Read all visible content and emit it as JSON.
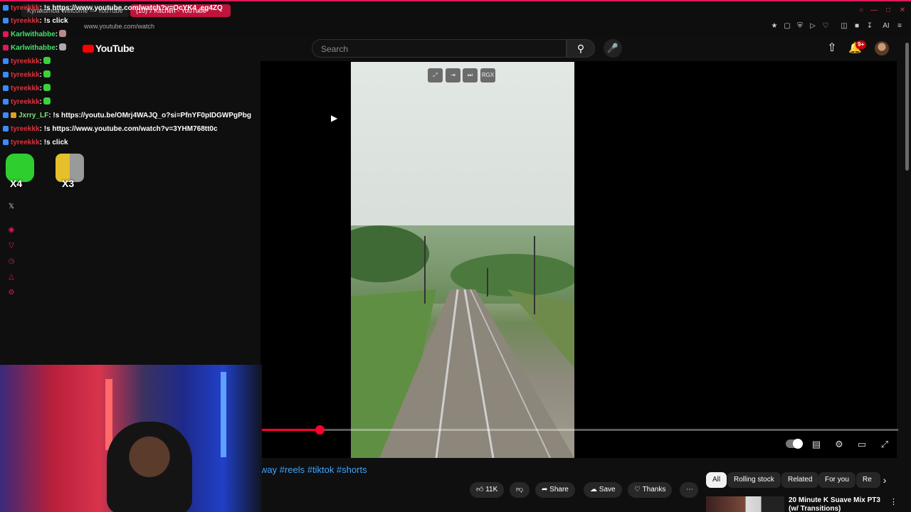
{
  "browser": {
    "tabs": [
      "Kyrakumba Welcome — YouTube",
      "(10) ♪ Kitchen - YouTube"
    ],
    "url": "www.youtube.com/watch"
  },
  "youtube": {
    "logo_text": "YouTube",
    "search_placeholder": "Search",
    "notification_count": "9+"
  },
  "player": {
    "overlay_buttons": [
      "⤢",
      "⇥",
      "⏭",
      "RGX"
    ],
    "progress_fraction": 0.093
  },
  "video": {
    "title_visible": "way #reels #tiktok #shorts",
    "actions": {
      "like_count": "11K",
      "share": "Share",
      "save": "Save",
      "thanks": "Thanks"
    }
  },
  "chips": [
    "All",
    "Rolling stock",
    "Related",
    "For you",
    "Re"
  ],
  "recommendation": {
    "title": "20 Minute K Suave Mix PT3 (w/ Transitions)"
  },
  "chat": [
    {
      "user": "tyreekkk",
      "message": ": !s https://www.youtube.com/watch?v=OcYK4_eg4ZQ",
      "style": "red",
      "emote": false
    },
    {
      "user": "tyreekkk",
      "message": ": !s click",
      "style": "red",
      "emote": false
    },
    {
      "user": "Karlwithabbe",
      "message": ":",
      "style": "green",
      "emote": true
    },
    {
      "user": "Karlwithabbe",
      "message": ":",
      "style": "green",
      "emote": true
    },
    {
      "user": "tyreekkk",
      "message": ":",
      "style": "red",
      "emote": true
    },
    {
      "user": "tyreekkk",
      "message": ":",
      "style": "red",
      "emote": true
    },
    {
      "user": "tyreekkk",
      "message": ":",
      "style": "red",
      "emote": true
    },
    {
      "user": "tyreekkk",
      "message": ":",
      "style": "red",
      "emote": true
    },
    {
      "user": "Jxrry_LF",
      "message": ": !s https://youtu.be/OMrj4WAJQ_o?si=PfnYF0pIDGWPgPbg",
      "style": "lgreen",
      "emote": false
    },
    {
      "user": "tyreekkk",
      "message": ": !s https://www.youtube.com/watch?v=3YHM768tt0c",
      "style": "red",
      "emote": false
    },
    {
      "user": "tyreekkk",
      "message": ": !s click",
      "style": "red",
      "emote": false
    }
  ],
  "emote_counts": [
    "X4",
    "X3"
  ]
}
